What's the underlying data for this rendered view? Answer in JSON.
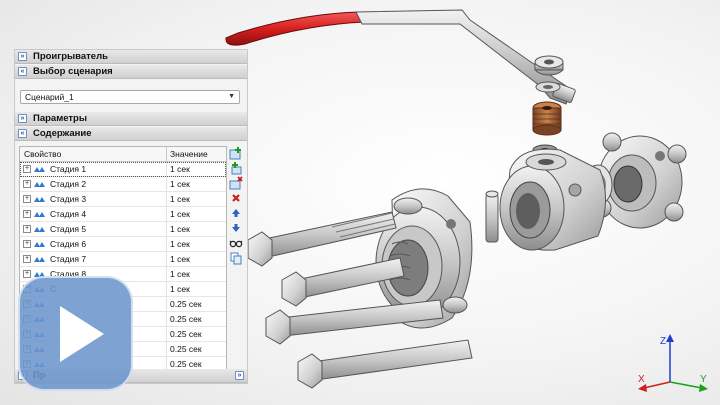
{
  "panel": {
    "sections": {
      "player": "Проигрыватель",
      "scenario_choice": "Выбор сценария",
      "parameters": "Параметры",
      "contents": "Содержание",
      "bottom": "Пр"
    },
    "scenario_select": {
      "value": "Сценарий_1"
    },
    "grid": {
      "columns": [
        "Свойство",
        "Значение"
      ],
      "rows": [
        {
          "name": "Стадия 1",
          "value": "1 сек"
        },
        {
          "name": "Стадия 2",
          "value": "1 сек"
        },
        {
          "name": "Стадия 3",
          "value": "1 сек"
        },
        {
          "name": "Стадия 4",
          "value": "1 сек"
        },
        {
          "name": "Стадия 5",
          "value": "1 сек"
        },
        {
          "name": "Стадия 6",
          "value": "1 сек"
        },
        {
          "name": "Стадия 7",
          "value": "1 сек"
        },
        {
          "name": "Стадия 8",
          "value": "1 сек"
        },
        {
          "name": "С",
          "value": "1 сек"
        },
        {
          "name": "",
          "value": "0.25 сек"
        },
        {
          "name": "",
          "value": "0.25 сек"
        },
        {
          "name": "",
          "value": "0.25 сек"
        },
        {
          "name": "",
          "value": "0.25 сек"
        },
        {
          "name": "",
          "value": "0.25 сек"
        }
      ]
    },
    "toolbar_icons": [
      "add-stage-icon",
      "add-substage-icon",
      "add-action-icon",
      "delete-icon",
      "move-up-icon",
      "move-down-icon",
      "glasses-icon",
      "copy-icon"
    ]
  },
  "triad": {
    "x": "X",
    "y": "Y",
    "z": "Z"
  },
  "colors": {
    "handle": "#d81f1f",
    "accent": "#2c5aa0",
    "play": "#6c96cd",
    "brass": "#b0703f"
  }
}
